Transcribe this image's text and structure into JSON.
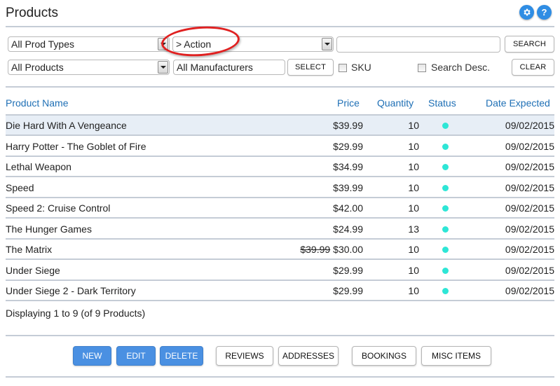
{
  "header": {
    "title": "Products",
    "settings_icon": "gear-icon",
    "help_icon": "question-icon",
    "help_glyph": "?"
  },
  "filters": {
    "prod_type_select": "All Prod Types",
    "category_select": "> Action",
    "search_input_value": "",
    "search_button": "SEARCH",
    "products_select": "All Products",
    "manufacturers_field": "All Manufacturers",
    "select_button": "SELECT",
    "sku_label": "SKU",
    "sku_checked": false,
    "search_desc_label": "Search Desc.",
    "search_desc_checked": false,
    "clear_button": "CLEAR"
  },
  "table": {
    "columns": [
      "Product Name",
      "Price",
      "Quantity",
      "Status",
      "Date Expected"
    ],
    "status_color": "#2ee6d6",
    "rows": [
      {
        "name": "Die Hard With A Vengeance",
        "old_price": "",
        "price": "$39.99",
        "qty": "10",
        "status": "active",
        "date": "09/02/2015",
        "selected": true
      },
      {
        "name": "Harry Potter - The Goblet of Fire",
        "old_price": "",
        "price": "$29.99",
        "qty": "10",
        "status": "active",
        "date": "09/02/2015"
      },
      {
        "name": "Lethal Weapon",
        "old_price": "",
        "price": "$34.99",
        "qty": "10",
        "status": "active",
        "date": "09/02/2015"
      },
      {
        "name": "Speed",
        "old_price": "",
        "price": "$39.99",
        "qty": "10",
        "status": "active",
        "date": "09/02/2015"
      },
      {
        "name": "Speed 2: Cruise Control",
        "old_price": "",
        "price": "$42.00",
        "qty": "10",
        "status": "active",
        "date": "09/02/2015"
      },
      {
        "name": "The Hunger Games",
        "old_price": "",
        "price": "$24.99",
        "qty": "13",
        "status": "active",
        "date": "09/02/2015"
      },
      {
        "name": "The Matrix",
        "old_price": "$39.99",
        "price": "$30.00",
        "qty": "10",
        "status": "active",
        "date": "09/02/2015"
      },
      {
        "name": "Under Siege",
        "old_price": "",
        "price": "$29.99",
        "qty": "10",
        "status": "active",
        "date": "09/02/2015"
      },
      {
        "name": "Under Siege 2 - Dark Territory",
        "old_price": "",
        "price": "$29.99",
        "qty": "10",
        "status": "active",
        "date": "09/02/2015"
      }
    ],
    "footer": "Displaying 1 to 9 (of 9 Products)"
  },
  "actions": {
    "new": "NEW",
    "edit": "EDIT",
    "delete": "DELETE",
    "reviews": "REVIEWS",
    "addresses": "ADDRESSES",
    "bookings": "BOOKINGS",
    "misc_items": "MISC ITEMS",
    "primary_color": "#4a90e2"
  }
}
